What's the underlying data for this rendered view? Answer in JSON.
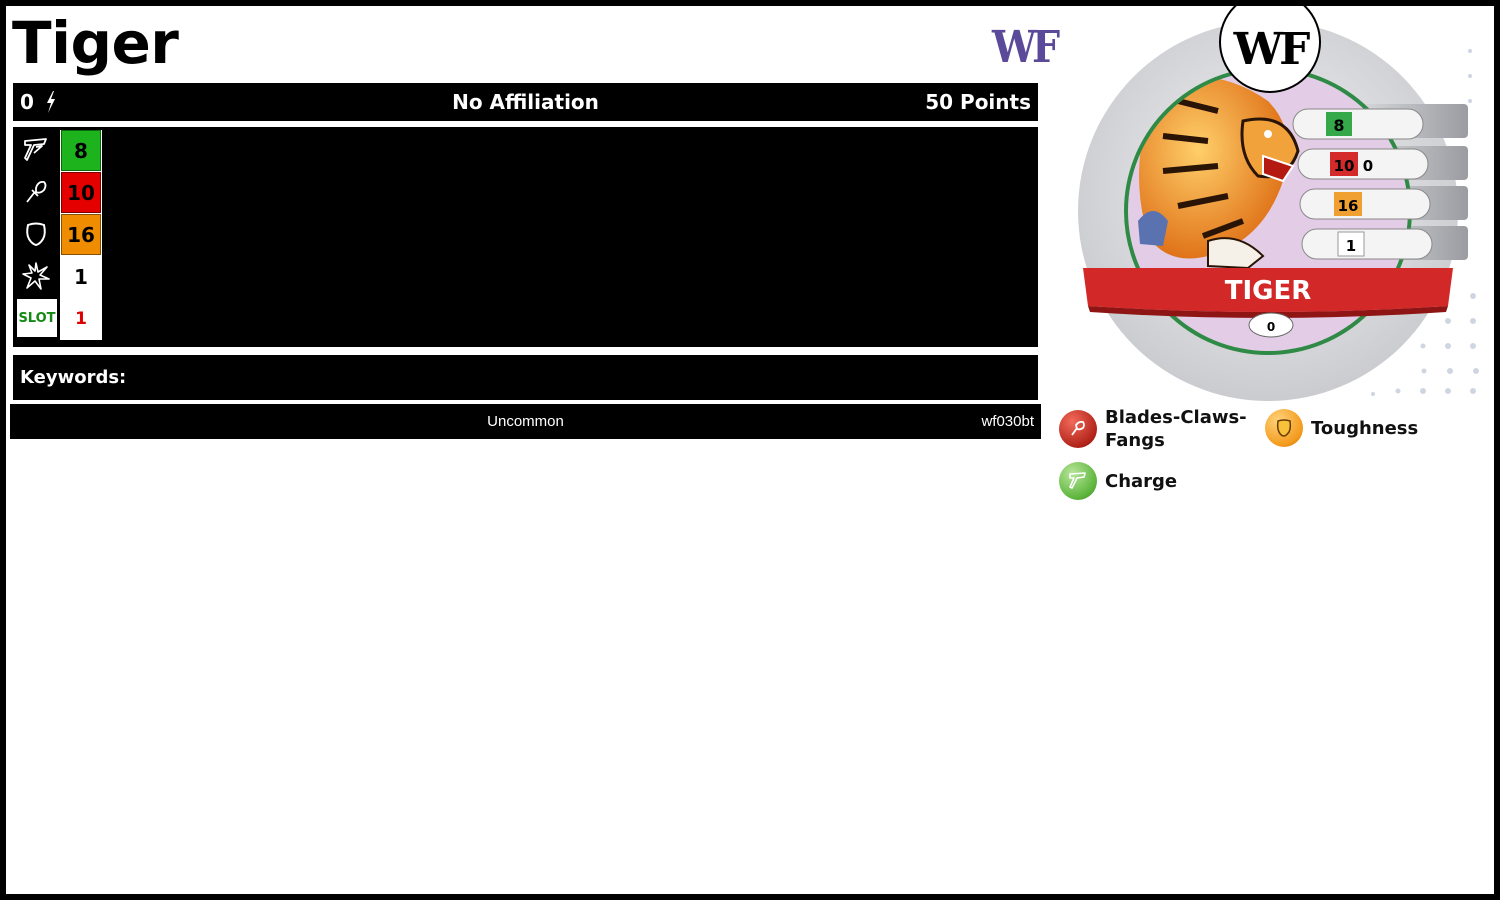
{
  "card": {
    "name": "Tiger",
    "set_logo": "WF",
    "cost": "0",
    "affiliation": "No Affiliation",
    "points": "50 Points",
    "keywords_label": "Keywords:",
    "rarity": "Uncommon",
    "code": "wf030bt"
  },
  "stats": [
    {
      "icon": "speed-icon",
      "value": "8",
      "color": "#1db31d"
    },
    {
      "icon": "attack-icon",
      "value": "10",
      "color": "#e50000"
    },
    {
      "icon": "defense-icon",
      "value": "16",
      "color": "#f08c00"
    },
    {
      "icon": "damage-icon",
      "value": "1",
      "color": "#ffffff"
    },
    {
      "icon": "slot-icon",
      "label": "SLOT",
      "value": "1",
      "color": "#ffffff"
    }
  ],
  "token": {
    "set_logo": "WF",
    "name": "TIGER",
    "point_value": "0",
    "dial": [
      "8",
      "10",
      "0",
      "16",
      "1"
    ]
  },
  "powers": [
    {
      "name": "Blades-Claws-\nFangs",
      "color": "#c0392b",
      "icon": "blades-claws-fangs-icon"
    },
    {
      "name": "Toughness",
      "color": "#f39a1c",
      "icon": "toughness-icon"
    },
    {
      "name": "Charge",
      "color": "#5bb43a",
      "icon": "charge-icon"
    }
  ]
}
